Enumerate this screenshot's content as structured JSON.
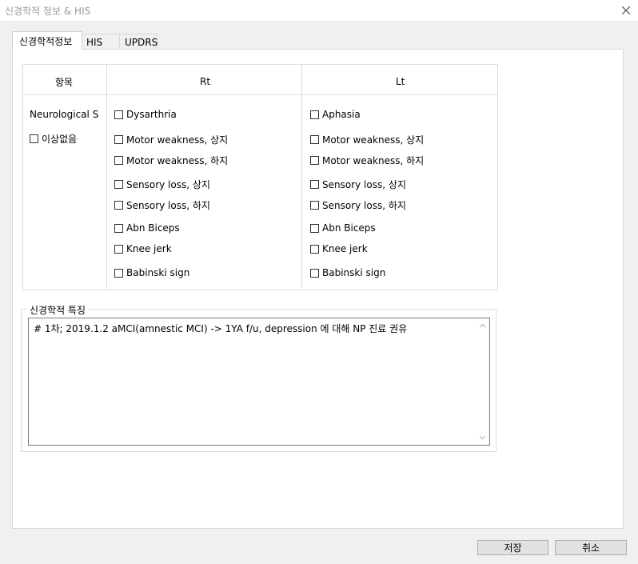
{
  "window": {
    "title": "신경학적 정보 & HIS"
  },
  "tabs": [
    {
      "label": "신경학적정보",
      "active": true
    },
    {
      "label": "HIS",
      "active": false
    },
    {
      "label": "UPDRS",
      "active": false
    }
  ],
  "table": {
    "headers": {
      "item": "항목",
      "right": "Rt",
      "left": "Lt"
    },
    "row_label": "Neurological S",
    "no_abnormality": {
      "label": "이상없음",
      "checked": false
    },
    "rt_items": [
      {
        "label": "Dysarthria",
        "checked": false
      },
      {
        "label": "Motor weakness, 상지",
        "checked": false
      },
      {
        "label": "Motor weakness, 하지",
        "checked": false
      },
      {
        "label": "Sensory loss, 상지",
        "checked": false
      },
      {
        "label": "Sensory loss, 하지",
        "checked": false
      },
      {
        "label": "Abn Biceps",
        "checked": false
      },
      {
        "label": "Knee jerk",
        "checked": false
      },
      {
        "label": "Babinski sign",
        "checked": false
      }
    ],
    "lt_items": [
      {
        "label": "Aphasia",
        "checked": false
      },
      {
        "label": "Motor weakness, 상지",
        "checked": false
      },
      {
        "label": "Motor weakness, 하지",
        "checked": false
      },
      {
        "label": "Sensory loss, 상지",
        "checked": false
      },
      {
        "label": "Sensory loss, 하지",
        "checked": false
      },
      {
        "label": "Abn Biceps",
        "checked": false
      },
      {
        "label": "Knee jerk",
        "checked": false
      },
      {
        "label": "Babinski sign",
        "checked": false
      }
    ]
  },
  "features": {
    "legend": "신경학적 특징",
    "text": "# 1차; 2019.1.2 aMCI(amnestic MCI) -> 1YA f/u, depression 에 대해 NP 진료 권유"
  },
  "buttons": {
    "save": "저장",
    "cancel": "취소"
  }
}
